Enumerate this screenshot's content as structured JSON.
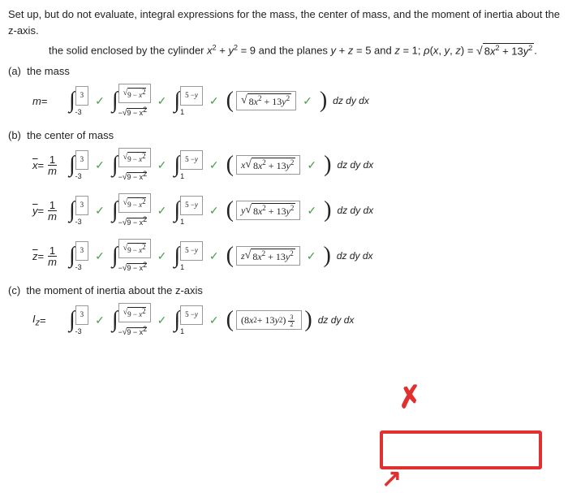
{
  "instruction": "Set up, but do not evaluate, integral expressions for the mass, the center of mass, and the moment of inertia about the z-axis.",
  "sub_instruction_html": "the solid enclosed by the cylinder x² + y² = 9 and the planes y + z = 5 and z = 1; ρ(x, y, z) = √(8x² + 13y²).",
  "parts": {
    "a": {
      "label": "(a)",
      "title": "the mass"
    },
    "b": {
      "label": "(b)",
      "title": "the center of mass"
    },
    "c": {
      "label": "(c)",
      "title": "the moment of inertia about the z-axis"
    }
  },
  "limits": {
    "x_lo": "-3",
    "x_hi": "3",
    "y_lo_html": "−√(9 − x²)",
    "y_hi_html": "√(9 − x²)",
    "z_lo": "1",
    "z_hi": "5 − y"
  },
  "integrands": {
    "mass": "√(8x² + 13y²)",
    "xbar": "x√(8x² + 13y²)",
    "ybar": "y√(8x² + 13y²)",
    "zbar": "z√(8x² + 13y²)",
    "Iz": "(8x² + 13y²)^{3/2}"
  },
  "diff": "dz dy dx",
  "lhs": {
    "mass": "m =",
    "xbar": "x̄ =",
    "ybar": "ȳ =",
    "zbar": "z̄ =",
    "Iz": "I_z =",
    "one_over_m": "1/m"
  },
  "marks": {
    "ok": "✓",
    "bad": "✗"
  },
  "chart_data": {
    "type": "table",
    "description": "Triple-integral setups over solid bounded by x²+y²=9, y+z=5, z=1 with density ρ=√(8x²+13y²)",
    "common_limits": {
      "x": [
        -3,
        3
      ],
      "y": [
        "-√(9-x²)",
        "√(9-x²)"
      ],
      "z": [
        1,
        "5-y"
      ]
    },
    "rows": [
      {
        "quantity": "m",
        "integrand": "√(8x²+13y²)",
        "prefactor": 1,
        "graded": "correct"
      },
      {
        "quantity": "x̄",
        "integrand": "x√(8x²+13y²)",
        "prefactor": "1/m",
        "graded": "correct"
      },
      {
        "quantity": "ȳ",
        "integrand": "y√(8x²+13y²)",
        "prefactor": "1/m",
        "graded": "correct"
      },
      {
        "quantity": "z̄",
        "integrand": "z√(8x²+13y²)",
        "prefactor": "1/m",
        "graded": "correct"
      },
      {
        "quantity": "I_z",
        "integrand": "(8x²+13y²)^{3/2}",
        "prefactor": 1,
        "graded": "incorrect"
      }
    ]
  }
}
